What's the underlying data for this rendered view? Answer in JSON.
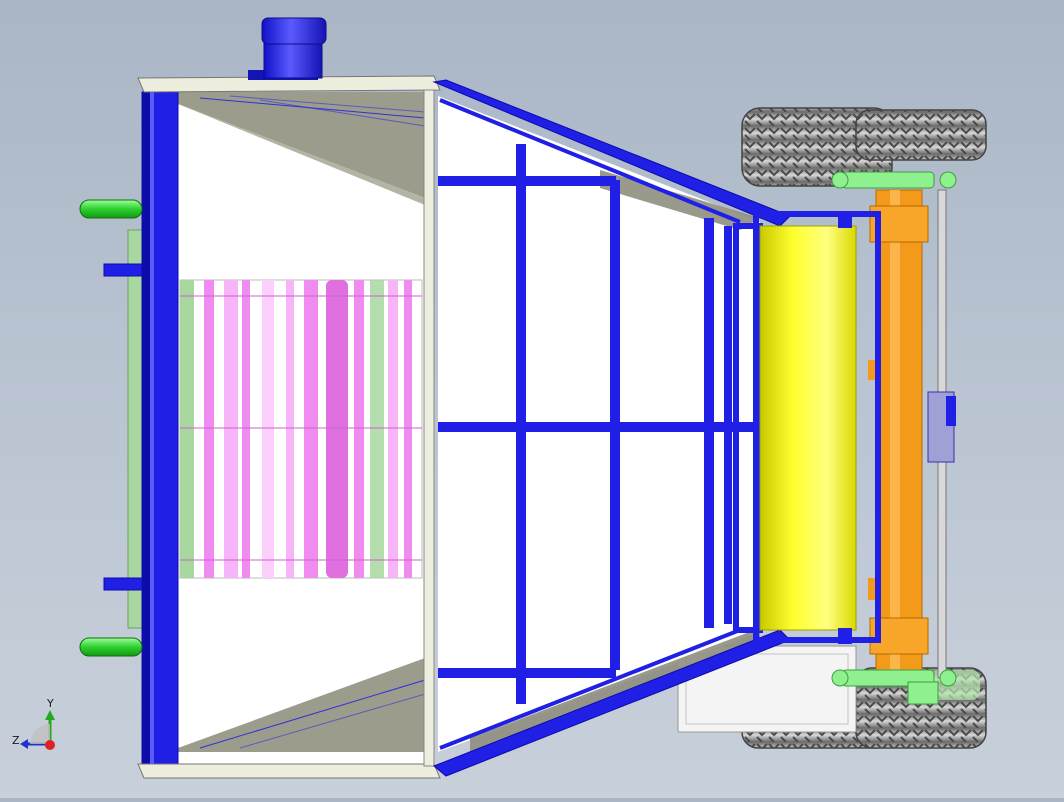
{
  "viewport": {
    "background_top": "#aab6c6",
    "background_bottom": "#c8d0da"
  },
  "colors": {
    "frame_blue": "#1f1fe6",
    "frame_blue_dark": "#0c0caa",
    "frame_edge": "#eeeede",
    "roller_yellow": "#f2f200",
    "axle_orange": "#f39a1a",
    "filter_pink": "#f08cf0",
    "panel_green": "#a8d8a0",
    "bracket_green": "#8ff08f",
    "pipe_green": "#3ed83e",
    "tire_gray": "#9a9a9a"
  },
  "parts": [
    "motor-housing",
    "intake-pipes",
    "box-frame",
    "filter-screen",
    "hopper-frame",
    "feed-roller",
    "axle-assembly",
    "wheels"
  ],
  "triad": {
    "y_label": "Y",
    "z_label": "Z",
    "y_color": "#22aa22",
    "z_color": "#2233cc",
    "x_color": "#dd2222"
  }
}
